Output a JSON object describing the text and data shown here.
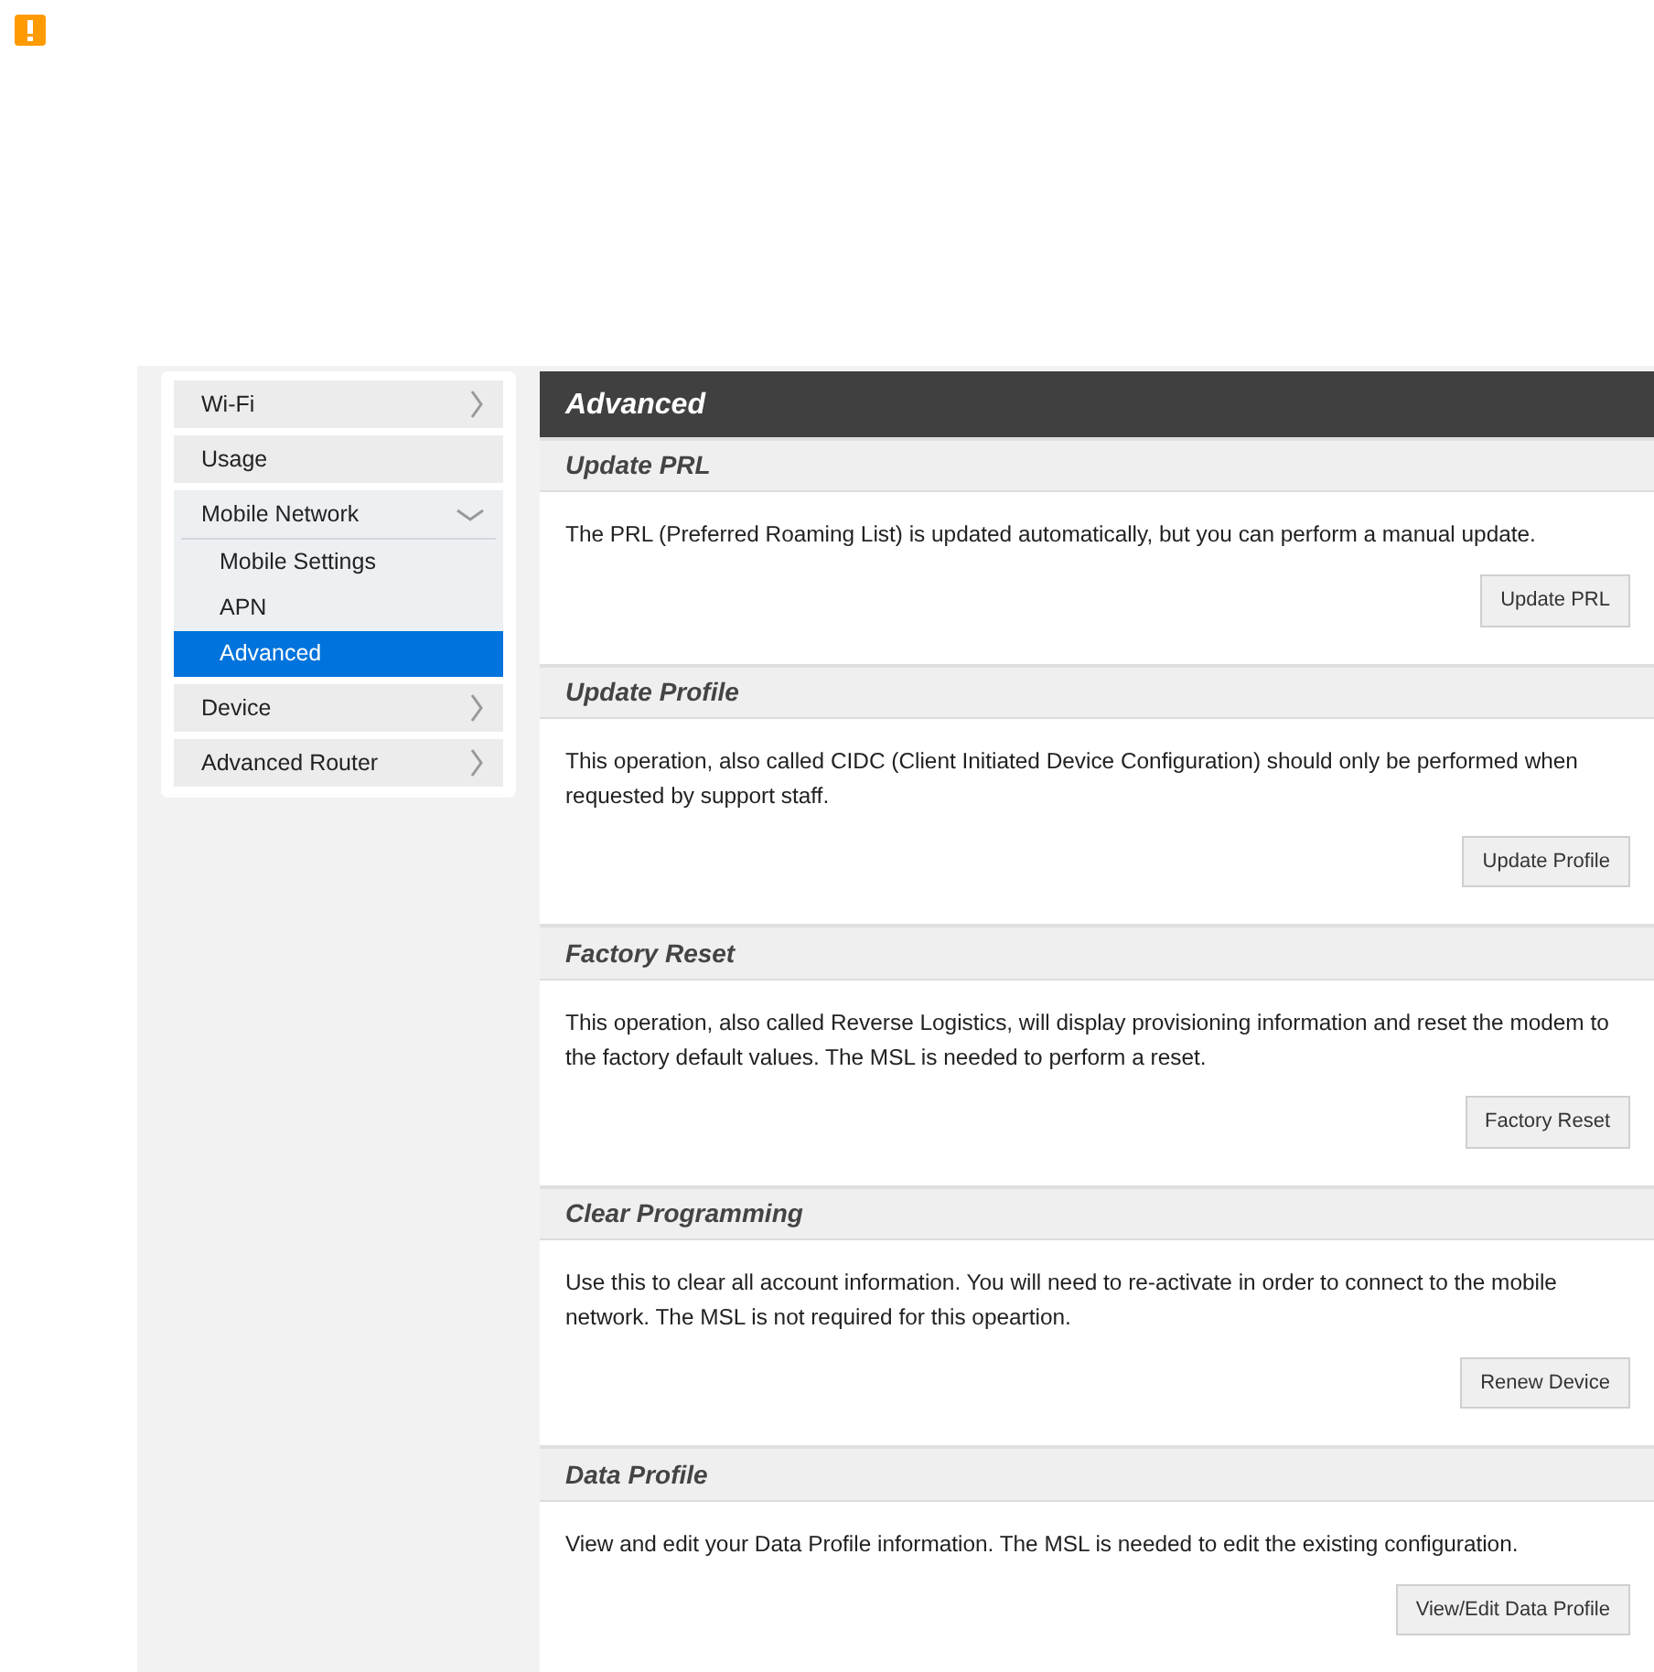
{
  "alert": {
    "kind": "warning"
  },
  "sidebar": {
    "items": [
      {
        "label": "Wi-Fi",
        "kind": "menu",
        "expanded": false
      },
      {
        "label": "Usage",
        "kind": "link",
        "expanded": false
      },
      {
        "label": "Mobile Network",
        "kind": "menu",
        "expanded": true,
        "children": [
          {
            "label": "Mobile Settings",
            "selected": false
          },
          {
            "label": "APN",
            "selected": false
          },
          {
            "label": "Advanced",
            "selected": true
          }
        ]
      },
      {
        "label": "Device",
        "kind": "menu",
        "expanded": false
      },
      {
        "label": "Advanced Router",
        "kind": "menu",
        "expanded": false
      }
    ]
  },
  "panel": {
    "title": "Advanced",
    "sections": [
      {
        "title": "Update PRL",
        "text": "The PRL (Preferred Roaming List) is updated automatically, but you can perform a manual update.",
        "button": "Update PRL"
      },
      {
        "title": "Update Profile",
        "text": "This operation, also called CIDC (Client Initiated Device Configuration) should only be performed when requested by support staff.",
        "button": "Update Profile"
      },
      {
        "title": "Factory Reset",
        "text": "This operation, also called Reverse Logistics, will display provisioning information and reset the modem to the factory default values. The MSL is needed to perform a reset.",
        "button": "Factory Reset"
      },
      {
        "title": "Clear Programming",
        "text": "Use this to clear all account information. You will need to re-activate in order to connect to the mobile network. The MSL is not required for this opeartion.",
        "button": "Renew Device"
      },
      {
        "title": "Data Profile",
        "text": "View and edit your Data Profile information. The MSL is needed to edit the existing configuration.",
        "button": "View/Edit Data Profile"
      }
    ]
  }
}
